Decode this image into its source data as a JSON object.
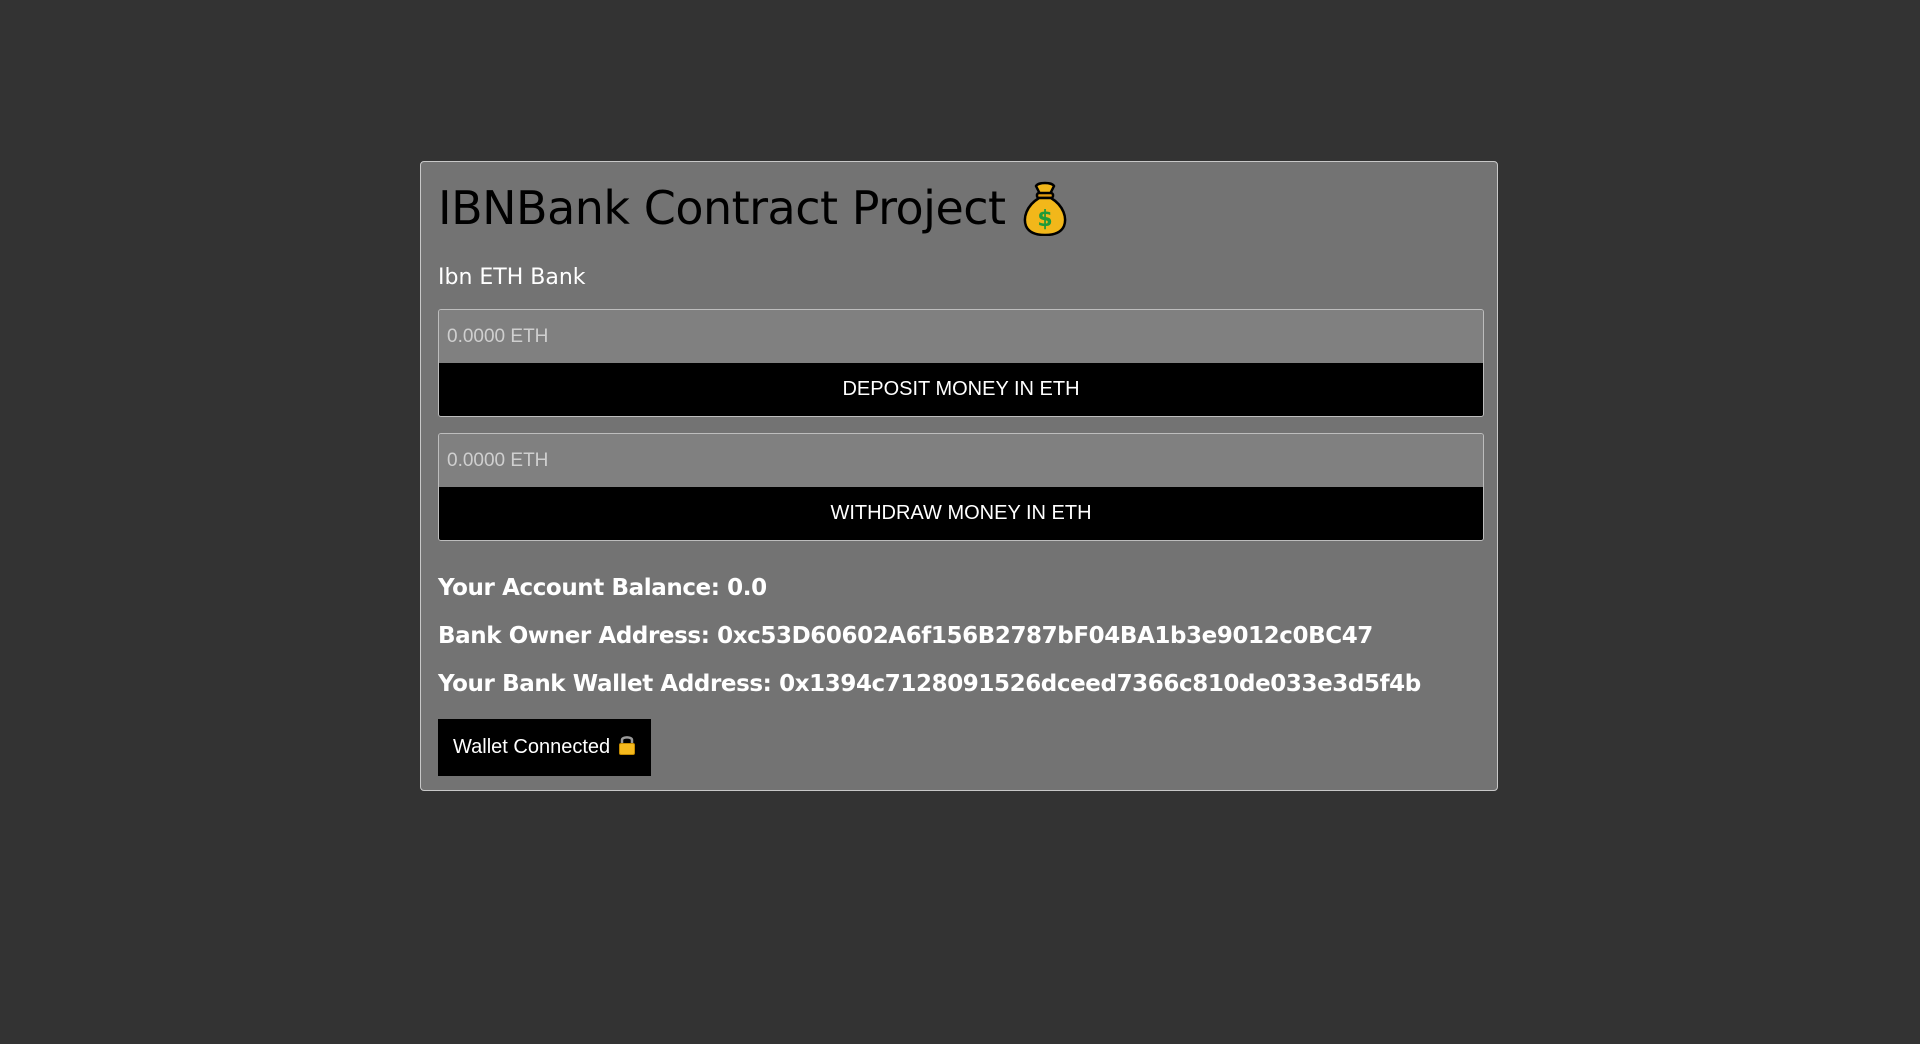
{
  "header": {
    "title": "IBNBank Contract Project",
    "subtitle": "Ibn ETH Bank"
  },
  "deposit": {
    "placeholder": "0.0000 ETH",
    "button_label": "DEPOSIT MONEY IN ETH"
  },
  "withdraw": {
    "placeholder": "0.0000 ETH",
    "button_label": "WITHDRAW MONEY IN ETH"
  },
  "account": {
    "balance_text": "Your Account Balance: 0.0",
    "owner_text": "Bank Owner Address: 0xc53D60602A6f156B2787bF04BA1b3e9012c0BC47",
    "wallet_text": "Your Bank Wallet Address: 0x1394c7128091526dceed7366c810de033e3d5f4b"
  },
  "wallet_button": {
    "label": "Wallet Connected",
    "icon": "lock-icon"
  },
  "colors": {
    "page_bg": "#333333",
    "card_bg": "#737373",
    "input_bg": "#808080",
    "button_bg": "#000000",
    "bag_gold": "#f2b71a",
    "bag_dollar": "#1f9a3a"
  }
}
